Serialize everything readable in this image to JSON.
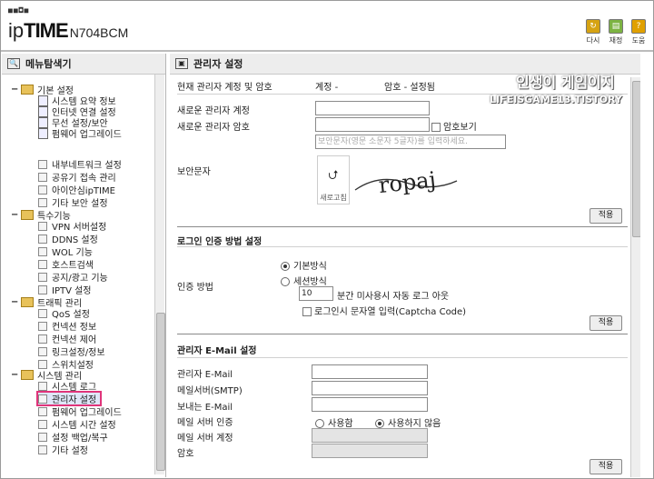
{
  "header": {
    "dots": "■■◘■",
    "brand_ip": "ip",
    "brand_time": "TIME",
    "model": "N704BCM",
    "tools": [
      {
        "label": "다시",
        "icon": "save-icon"
      },
      {
        "label": "재정",
        "icon": "restore-icon"
      },
      {
        "label": "도움",
        "icon": "help-icon"
      }
    ]
  },
  "sidebar": {
    "title": "메뉴탐색기",
    "items": [
      {
        "label": "기본 설정",
        "level": 0,
        "type": "folder"
      },
      {
        "label": "시스템 요약 정보",
        "level": 1,
        "type": "page"
      },
      {
        "label": "인터넷 연결 설정",
        "level": 1,
        "type": "page"
      },
      {
        "label": "무선 설정/보안",
        "level": 1,
        "type": "page"
      },
      {
        "label": "펌웨어 업그레이드",
        "level": 1,
        "type": "page"
      },
      {
        "label": "내부네트워크 설정",
        "level": 1,
        "type": "box"
      },
      {
        "label": "공유기 접속 관리",
        "level": 1,
        "type": "box"
      },
      {
        "label": "아이안심ipTIME",
        "level": 1,
        "type": "box"
      },
      {
        "label": "기타 보안 설정",
        "level": 1,
        "type": "box"
      },
      {
        "label": "특수기능",
        "level": 0,
        "type": "folder"
      },
      {
        "label": "VPN 서버설정",
        "level": 1,
        "type": "box"
      },
      {
        "label": "DDNS 설정",
        "level": 1,
        "type": "box"
      },
      {
        "label": "WOL 기능",
        "level": 1,
        "type": "box"
      },
      {
        "label": "호스트검색",
        "level": 1,
        "type": "box"
      },
      {
        "label": "공지/광고 기능",
        "level": 1,
        "type": "box"
      },
      {
        "label": "IPTV 설정",
        "level": 1,
        "type": "box"
      },
      {
        "label": "트래픽 관리",
        "level": 0,
        "type": "folder"
      },
      {
        "label": "QoS 설정",
        "level": 1,
        "type": "box"
      },
      {
        "label": "컨넥션 정보",
        "level": 1,
        "type": "box"
      },
      {
        "label": "컨넥션 제어",
        "level": 1,
        "type": "box"
      },
      {
        "label": "링크설정/정보",
        "level": 1,
        "type": "box"
      },
      {
        "label": "스위치설정",
        "level": 1,
        "type": "box"
      },
      {
        "label": "시스템 관리",
        "level": 0,
        "type": "folder"
      },
      {
        "label": "시스템 로그",
        "level": 1,
        "type": "box"
      },
      {
        "label": "관리자 설정",
        "level": 1,
        "type": "box",
        "selected": true
      },
      {
        "label": "펌웨어 업그레이드",
        "level": 1,
        "type": "box"
      },
      {
        "label": "시스템 시간 설정",
        "level": 1,
        "type": "box"
      },
      {
        "label": "설정 백업/복구",
        "level": 1,
        "type": "box"
      },
      {
        "label": "기타 설정",
        "level": 1,
        "type": "box"
      }
    ]
  },
  "main": {
    "title": "관리자 설정",
    "current_account_label": "현재 관리자 계정 및 암호",
    "current_account_value": "계정 - ",
    "current_password_status": "암호 - 설정됨",
    "new_account_label": "새로운 관리자 계정",
    "new_password_label": "새로운 관리자 암호",
    "show_password_label": "암호보기",
    "captcha_label": "보안문자",
    "captcha_placeholder": "보안문자(영문 소문자 5글자)를 입력하세요.",
    "captcha_refresh_label": "새로고침",
    "captcha_text": "ropaj",
    "apply_label": "적용",
    "login_section_title": "로그인 인증 방법 설정",
    "auth_method_label": "인증 방법",
    "auth_basic": "기본방식",
    "auth_session": "세션방식",
    "session_timeout_value": "10",
    "session_timeout_suffix": "분간 미사용시 자동 로그 아웃",
    "login_captcha_label": "로그인시 문자열 입력(Captcha Code)",
    "email_section_title": "관리자 E-Mail 설정",
    "admin_email_label": "관리자 E-Mail",
    "smtp_label": "메일서버(SMTP)",
    "sender_email_label": "보내는 E-Mail",
    "mail_auth_label": "메일 서버 인증",
    "mail_auth_use": "사용함",
    "mail_auth_nouse": "사용하지 않음",
    "mail_account_label": "메일 서버 계정",
    "mail_password_label": "암호"
  },
  "watermark": {
    "line1": "인생이 게임이지",
    "line2": "LIFEISGAME13.TISTORY"
  }
}
